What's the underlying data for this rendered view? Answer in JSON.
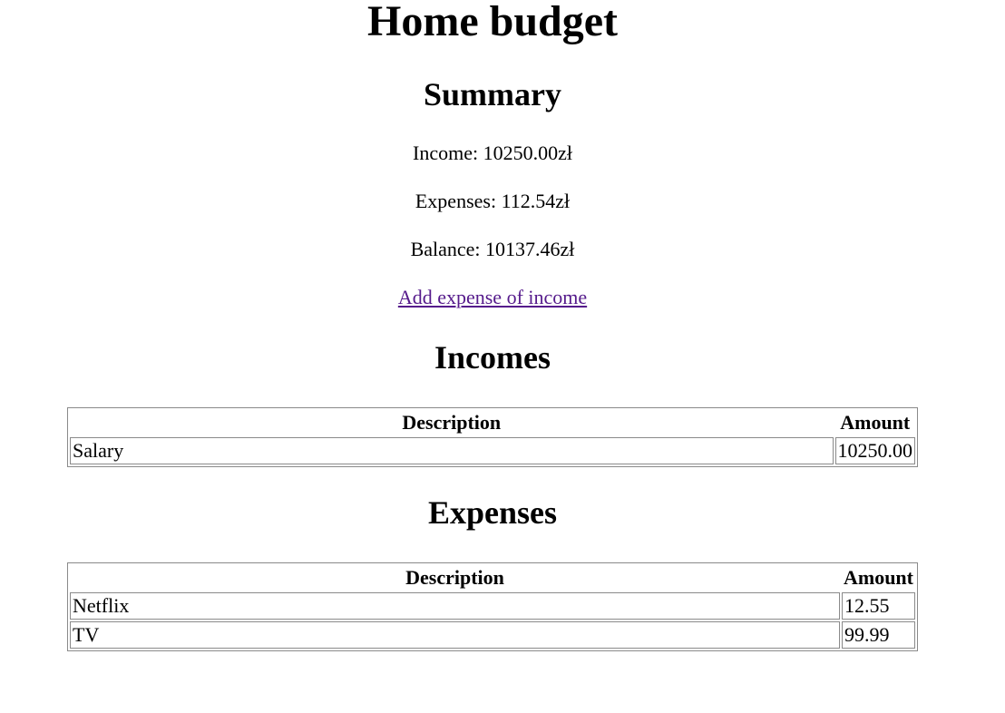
{
  "page": {
    "title": "Home budget"
  },
  "summary": {
    "heading": "Summary",
    "income": "Income: 10250.00zł",
    "expenses": "Expenses: 112.54zł",
    "balance": "Balance: 10137.46zł",
    "add_link": "Add expense of income"
  },
  "incomes": {
    "heading": "Incomes",
    "columns": [
      "Description",
      "Amount"
    ],
    "rows": [
      {
        "description": "Salary",
        "amount": "10250.00"
      }
    ]
  },
  "expenses": {
    "heading": "Expenses",
    "columns": [
      "Description",
      "Amount"
    ],
    "rows": [
      {
        "description": "Netflix",
        "amount": "12.55"
      },
      {
        "description": "TV",
        "amount": "99.99"
      }
    ]
  },
  "colors": {
    "link_visited": "#551a8b",
    "border": "#8a8a8a"
  }
}
